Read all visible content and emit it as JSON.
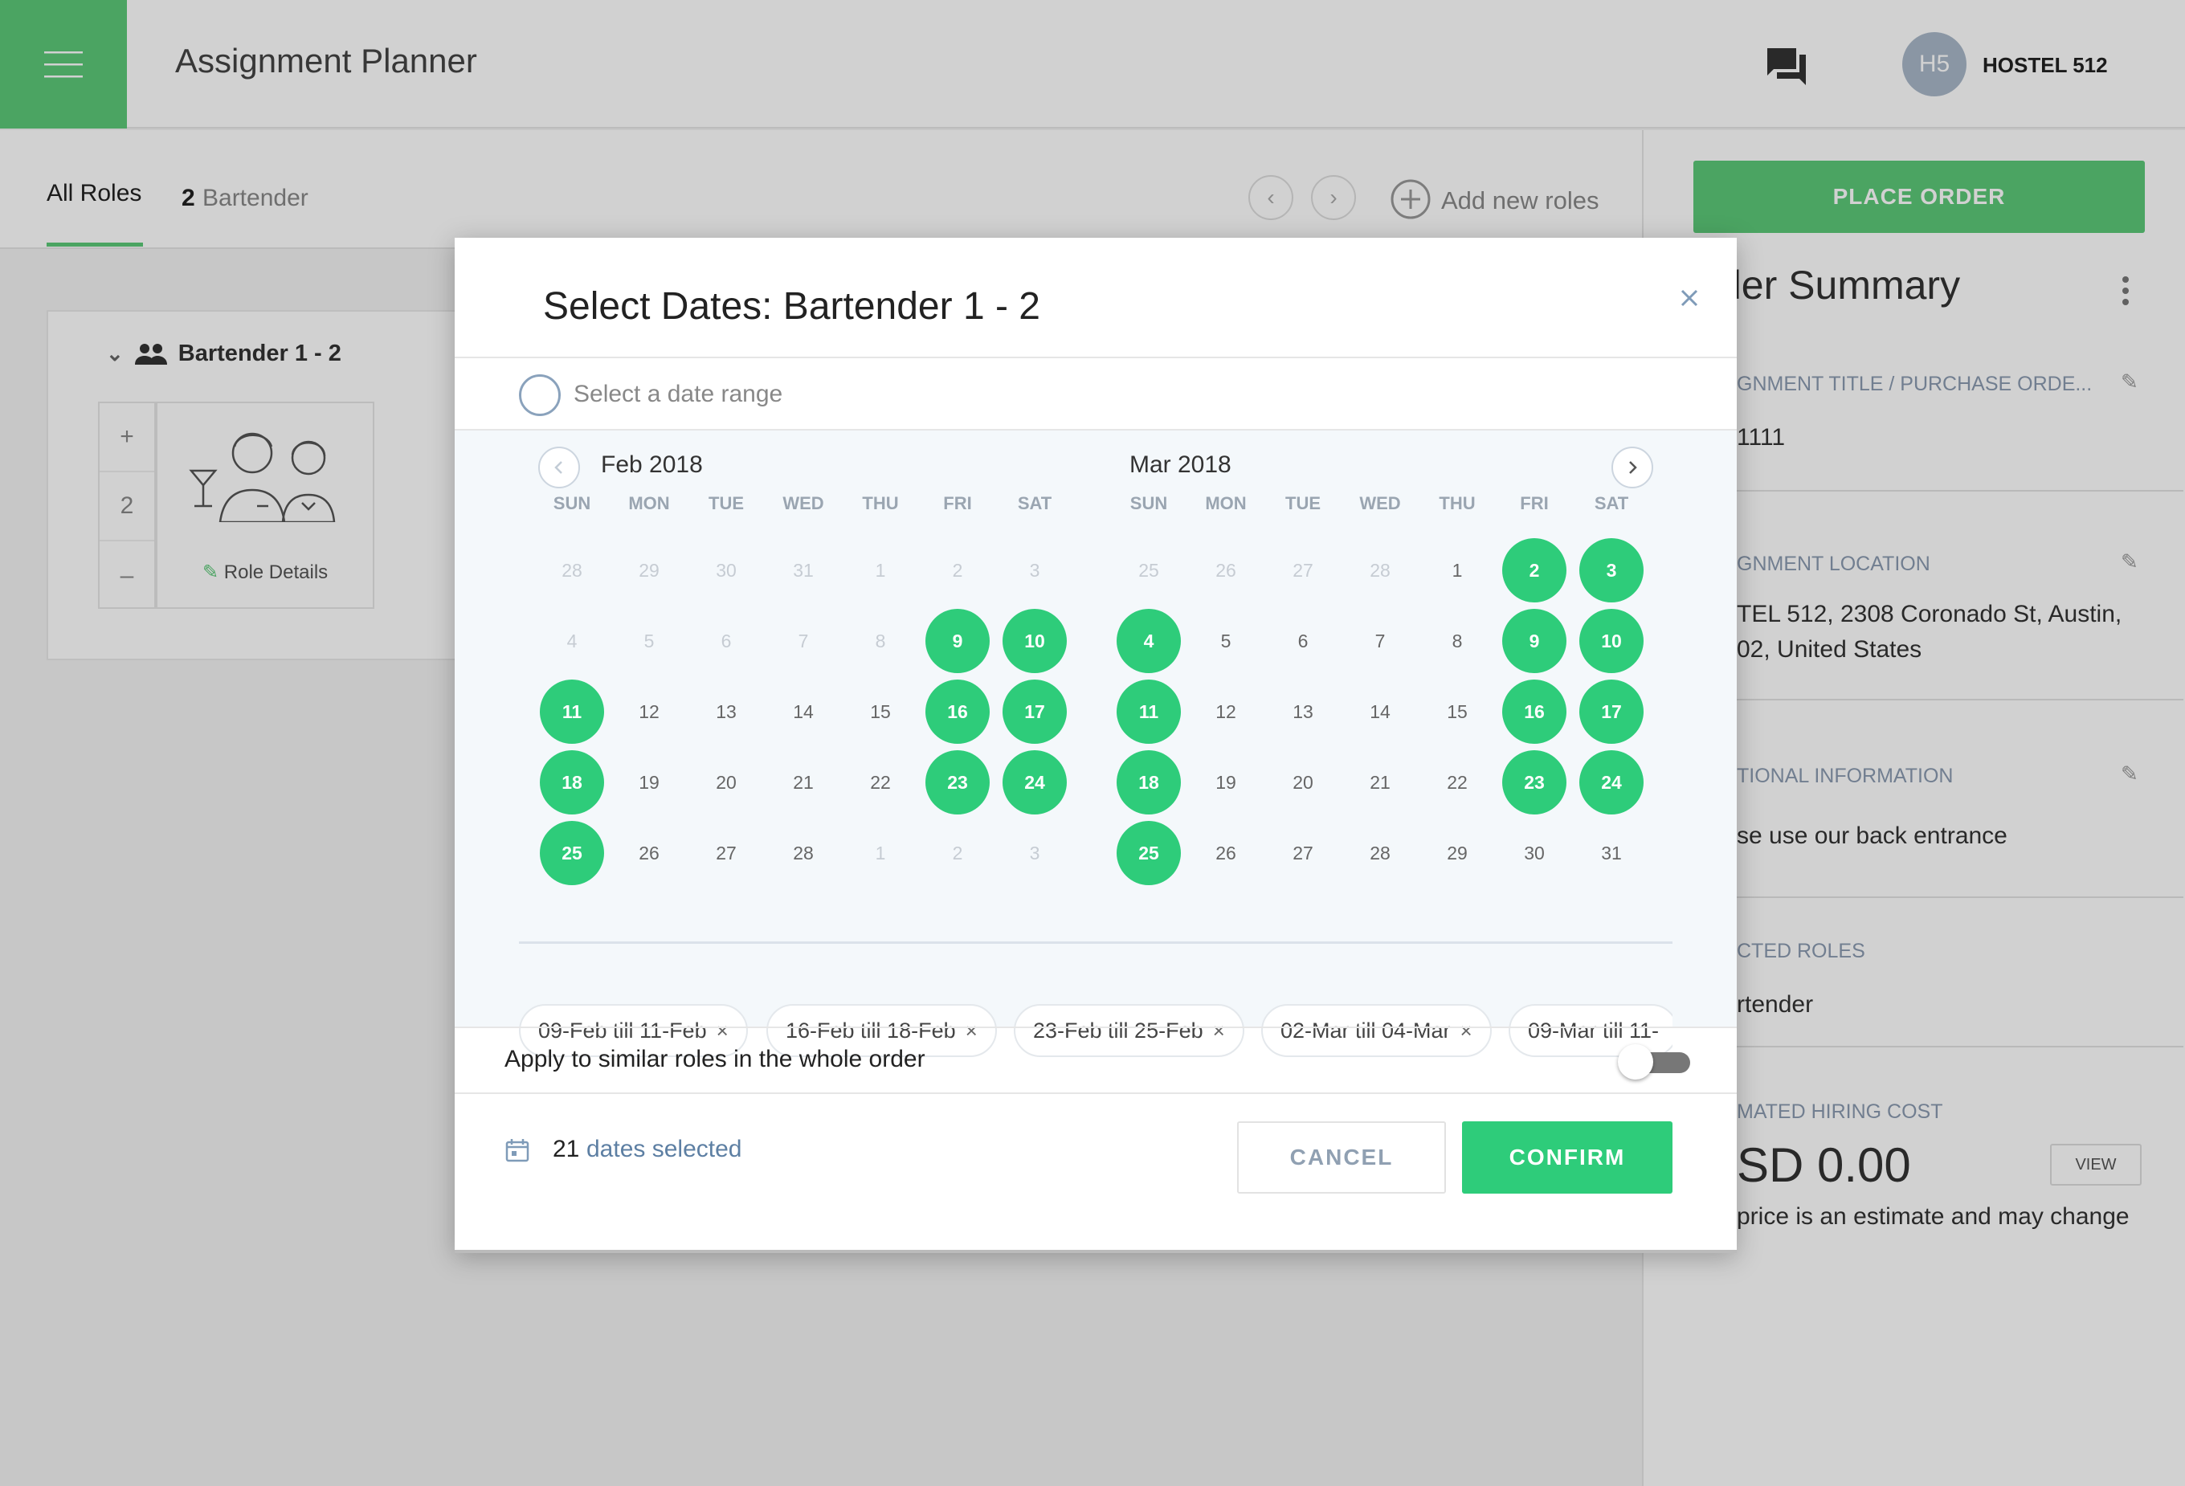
{
  "header": {
    "title": "Assignment Planner",
    "avatar_initials": "H5",
    "account_name": "HOSTEL 512",
    "accent_color": "#5cc878"
  },
  "tabs": {
    "all_roles": "All Roles",
    "role_count": "2",
    "role_name": "Bartender",
    "add_roles": "Add new roles"
  },
  "role_card": {
    "title": "Bartender 1 - 2",
    "plus": "+",
    "quantity": "2",
    "minus": "–",
    "details_label": "Role Details"
  },
  "summary": {
    "place_order": "PLACE ORDER",
    "title": "der Summary",
    "assignment_title_label": "GNMENT TITLE / PURCHASE ORDE...",
    "assignment_title_value": "1111",
    "location_label": "GNMENT LOCATION",
    "location_line1": "TEL 512, 2308 Coronado St, Austin,",
    "location_line2": "02, United States",
    "additional_label": "TIONAL INFORMATION",
    "additional_value": "se use our back entrance",
    "roles_label": "CTED ROLES",
    "roles_value": "rtender",
    "cost_label": "MATED HIRING COST",
    "cost_value": "SD 0.00",
    "view_label": "VIEW",
    "disclaimer": "price is an estimate and may change"
  },
  "modal": {
    "title": "Select Dates: Bartender 1 - 2",
    "range_label": "Select a date range",
    "dow": [
      "SUN",
      "MON",
      "TUE",
      "WED",
      "THU",
      "FRI",
      "SAT"
    ],
    "months": [
      {
        "title": "Feb 2018",
        "weeks": [
          [
            {
              "d": "28",
              "m": 1
            },
            {
              "d": "29",
              "m": 1
            },
            {
              "d": "30",
              "m": 1
            },
            {
              "d": "31",
              "m": 1
            },
            {
              "d": "1",
              "m": 1
            },
            {
              "d": "2",
              "m": 1
            },
            {
              "d": "3",
              "m": 1
            }
          ],
          [
            {
              "d": "4",
              "m": 1
            },
            {
              "d": "5",
              "m": 1
            },
            {
              "d": "6",
              "m": 1
            },
            {
              "d": "7",
              "m": 1
            },
            {
              "d": "8",
              "m": 1
            },
            {
              "d": "9",
              "s": 1
            },
            {
              "d": "10",
              "s": 1
            }
          ],
          [
            {
              "d": "11",
              "s": 1
            },
            {
              "d": "12"
            },
            {
              "d": "13"
            },
            {
              "d": "14"
            },
            {
              "d": "15"
            },
            {
              "d": "16",
              "s": 1
            },
            {
              "d": "17",
              "s": 1
            }
          ],
          [
            {
              "d": "18",
              "s": 1
            },
            {
              "d": "19"
            },
            {
              "d": "20"
            },
            {
              "d": "21"
            },
            {
              "d": "22"
            },
            {
              "d": "23",
              "s": 1
            },
            {
              "d": "24",
              "s": 1
            }
          ],
          [
            {
              "d": "25",
              "s": 1
            },
            {
              "d": "26"
            },
            {
              "d": "27"
            },
            {
              "d": "28"
            },
            {
              "d": "1",
              "m": 1
            },
            {
              "d": "2",
              "m": 1
            },
            {
              "d": "3",
              "m": 1
            }
          ]
        ]
      },
      {
        "title": "Mar 2018",
        "weeks": [
          [
            {
              "d": "25",
              "m": 1
            },
            {
              "d": "26",
              "m": 1
            },
            {
              "d": "27",
              "m": 1
            },
            {
              "d": "28",
              "m": 1
            },
            {
              "d": "1"
            },
            {
              "d": "2",
              "s": 1
            },
            {
              "d": "3",
              "s": 1
            }
          ],
          [
            {
              "d": "4",
              "s": 1
            },
            {
              "d": "5"
            },
            {
              "d": "6"
            },
            {
              "d": "7"
            },
            {
              "d": "8"
            },
            {
              "d": "9",
              "s": 1
            },
            {
              "d": "10",
              "s": 1
            }
          ],
          [
            {
              "d": "11",
              "s": 1
            },
            {
              "d": "12"
            },
            {
              "d": "13"
            },
            {
              "d": "14"
            },
            {
              "d": "15"
            },
            {
              "d": "16",
              "s": 1
            },
            {
              "d": "17",
              "s": 1
            }
          ],
          [
            {
              "d": "18",
              "s": 1
            },
            {
              "d": "19"
            },
            {
              "d": "20"
            },
            {
              "d": "21"
            },
            {
              "d": "22"
            },
            {
              "d": "23",
              "s": 1
            },
            {
              "d": "24",
              "s": 1
            }
          ],
          [
            {
              "d": "25",
              "s": 1
            },
            {
              "d": "26"
            },
            {
              "d": "27"
            },
            {
              "d": "28"
            },
            {
              "d": "29"
            },
            {
              "d": "30"
            },
            {
              "d": "31"
            }
          ]
        ]
      }
    ],
    "chips": [
      "09-Feb till 11-Feb",
      "16-Feb till 18-Feb",
      "23-Feb till 25-Feb",
      "02-Mar till 04-Mar",
      "09-Mar till 11-"
    ],
    "apply_label": "Apply to similar roles in the whole order",
    "apply_enabled": false,
    "dates_count": "21",
    "dates_label": "dates selected",
    "cancel": "CANCEL",
    "confirm": "CONFIRM",
    "selected_color": "#2ecc7a"
  }
}
